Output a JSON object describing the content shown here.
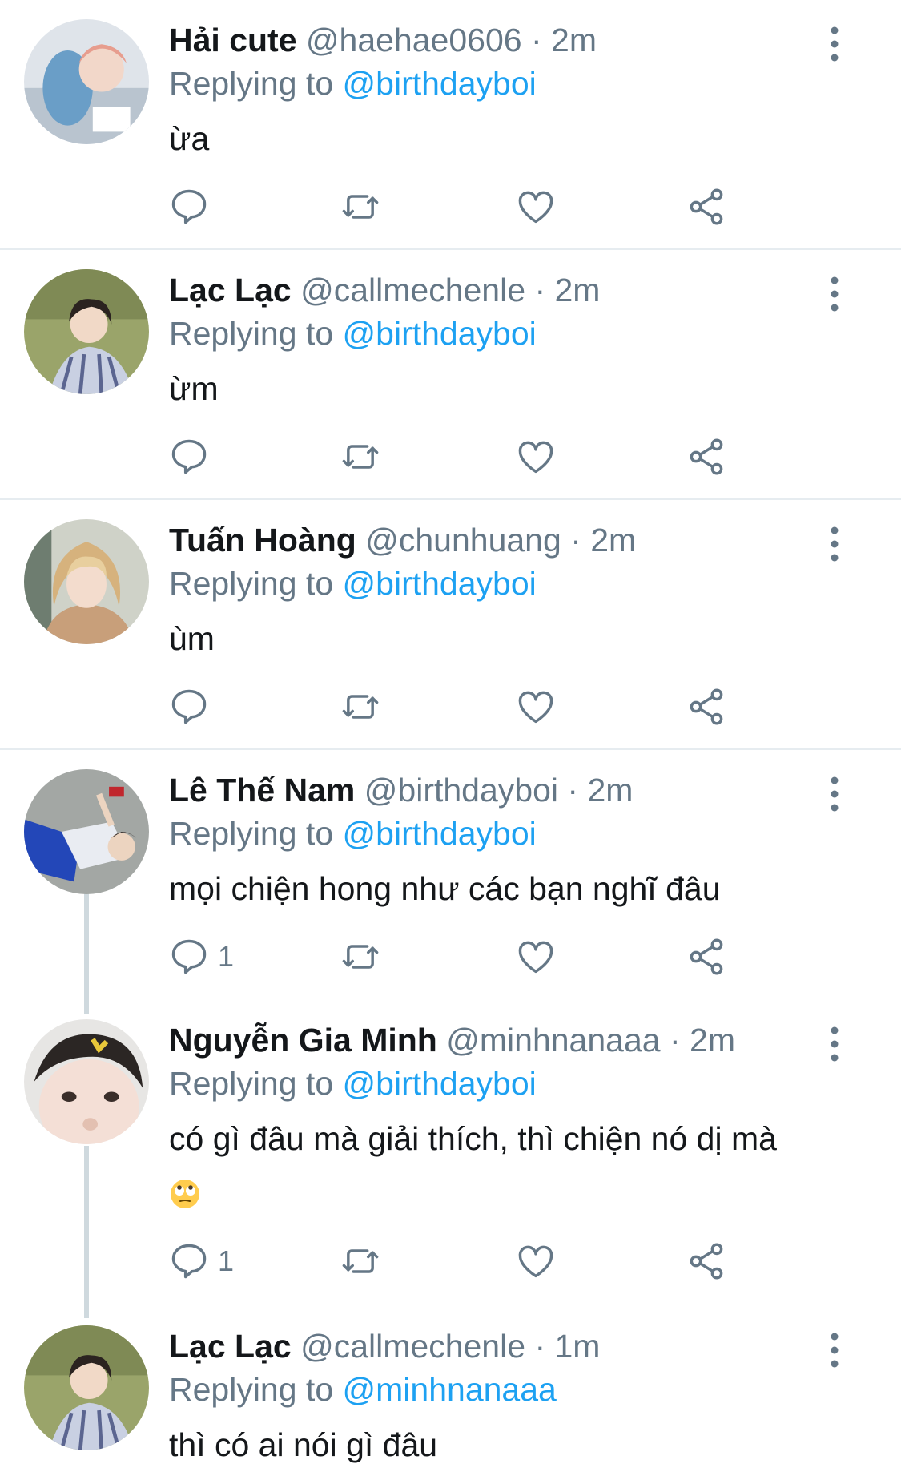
{
  "tweets": [
    {
      "name": "Hải cute",
      "handle": "@haehae0606",
      "time": "· 2m",
      "replying_label": "Replying to",
      "reply_to": "@birthdayboi",
      "text": "ừa",
      "reply_count": ""
    },
    {
      "name": "Lạc Lạc",
      "handle": "@callmechenle",
      "time": "· 2m",
      "replying_label": "Replying to",
      "reply_to": "@birthdayboi",
      "text": "ừm",
      "reply_count": ""
    },
    {
      "name": "Tuấn Hoàng",
      "handle": "@chunhuang",
      "time": "· 2m",
      "replying_label": "Replying to",
      "reply_to": "@birthdayboi",
      "text": "ùm",
      "reply_count": ""
    },
    {
      "name": "Lê Thế Nam",
      "handle": "@birthdayboi",
      "time": "· 2m",
      "replying_label": "Replying to",
      "reply_to": "@birthdayboi",
      "text": "mọi chiện hong như các bạn nghĩ đâu",
      "reply_count": "1"
    },
    {
      "name": "Nguyễn Gia Minh",
      "handle": "@minhnanaaa",
      "time": "· 2m",
      "replying_label": "Replying to",
      "reply_to": "@birthdayboi",
      "text": "có gì đâu mà giải thích, thì chiện nó dị mà",
      "emoji": "face-with-rolling-eyes",
      "reply_count": "1"
    },
    {
      "name": "Lạc Lạc",
      "handle": "@callmechenle",
      "time": "· 1m",
      "replying_label": "Replying to",
      "reply_to": "@minhnanaaa",
      "text": "thì có ai nói gì đâu",
      "reply_count": ""
    }
  ],
  "icons": {
    "reply": "reply-icon",
    "retweet": "retweet-icon",
    "like": "heart-icon",
    "share": "share-icon",
    "more": "more-vertical-icon"
  },
  "colors": {
    "link": "#1da1f2",
    "secondary": "#657786",
    "icon": "#657786",
    "divider": "#e6ecf0",
    "thread": "#cfd9de"
  }
}
